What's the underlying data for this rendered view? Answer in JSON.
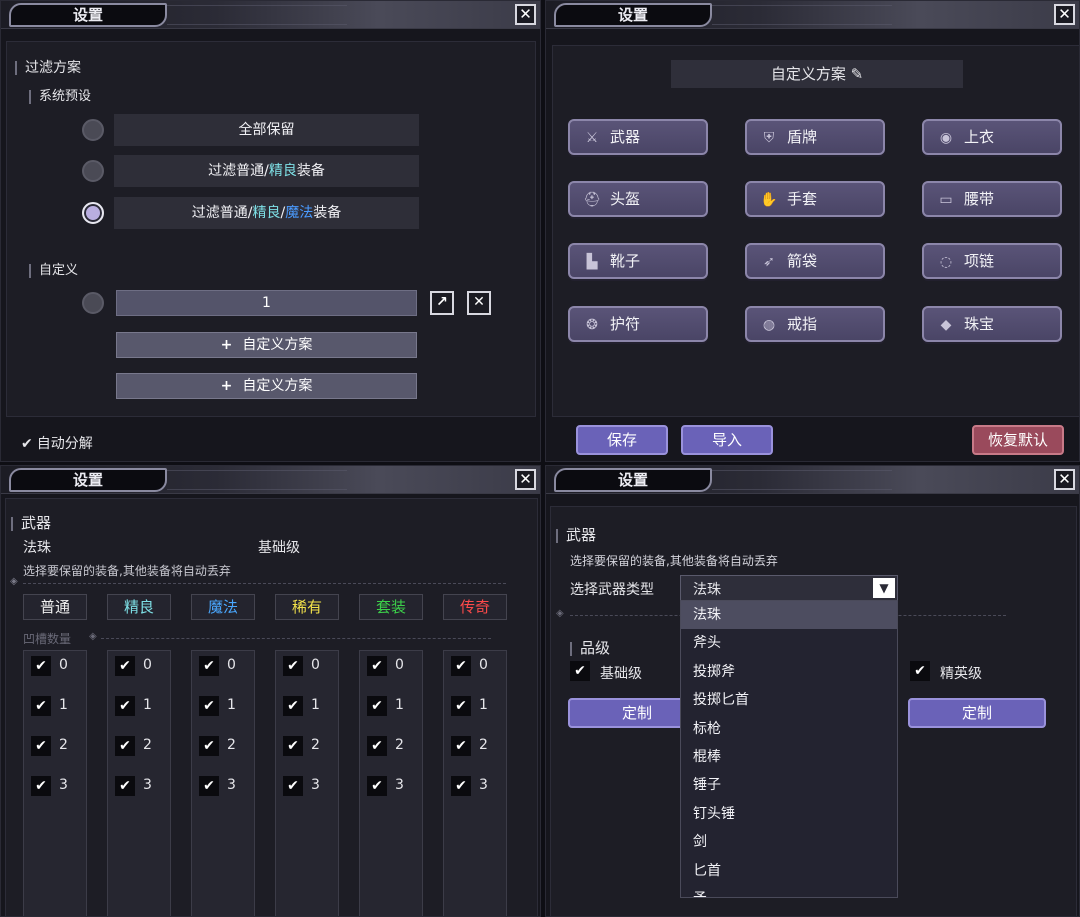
{
  "window_title": "设置",
  "close_glyph": "✕",
  "panel1": {
    "filter_title": "过滤方案",
    "system_preset": "系统预设",
    "options": [
      {
        "parts": [
          {
            "t": "全部保留",
            "c": ""
          }
        ]
      },
      {
        "parts": [
          {
            "t": "过滤普通/",
            "c": ""
          },
          {
            "t": "精良",
            "c": "#7ee0e6"
          },
          {
            "t": "装备",
            "c": ""
          }
        ]
      },
      {
        "parts": [
          {
            "t": "过滤普通/",
            "c": ""
          },
          {
            "t": "精良",
            "c": "#7ee0e6"
          },
          {
            "t": "/",
            "c": ""
          },
          {
            "t": "魔法",
            "c": "#4a9bff"
          },
          {
            "t": "装备",
            "c": ""
          }
        ]
      }
    ],
    "custom_title": "自定义",
    "custom_value": "1",
    "add_label": "自定义方案",
    "add_icon": "+",
    "auto_decompose": "自动分解",
    "check_glyph": "✔"
  },
  "panel2": {
    "scheme_name": "自定义方案",
    "edit_icon": "✎",
    "slots": [
      {
        "label": "武器",
        "icon": "sword-icon",
        "glyph": "⚔"
      },
      {
        "label": "盾牌",
        "icon": "shield-icon",
        "glyph": "⛨"
      },
      {
        "label": "上衣",
        "icon": "armor-icon",
        "glyph": "◉"
      },
      {
        "label": "头盔",
        "icon": "helmet-icon",
        "glyph": "⛑"
      },
      {
        "label": "手套",
        "icon": "glove-icon",
        "glyph": "✋"
      },
      {
        "label": "腰带",
        "icon": "belt-icon",
        "glyph": "▭"
      },
      {
        "label": "靴子",
        "icon": "boot-icon",
        "glyph": "▙"
      },
      {
        "label": "箭袋",
        "icon": "quiver-icon",
        "glyph": "➶"
      },
      {
        "label": "项链",
        "icon": "necklace-icon",
        "glyph": "◌"
      },
      {
        "label": "护符",
        "icon": "amulet-icon",
        "glyph": "❂"
      },
      {
        "label": "戒指",
        "icon": "ring-icon",
        "glyph": "◍"
      },
      {
        "label": "珠宝",
        "icon": "gem-icon",
        "glyph": "◆"
      }
    ],
    "save": "保存",
    "import": "导入",
    "reset": "恢复默认"
  },
  "panel3": {
    "section": "武器",
    "type": "法珠",
    "level": "基础级",
    "hint": "选择要保留的装备,其他装备将自动丢弃",
    "grades": [
      {
        "label": "普通",
        "color": "#f0f0f0"
      },
      {
        "label": "精良",
        "color": "#7ee0e6"
      },
      {
        "label": "魔法",
        "color": "#4aa8ff"
      },
      {
        "label": "稀有",
        "color": "#f2e24a"
      },
      {
        "label": "套装",
        "color": "#3cd04a"
      },
      {
        "label": "传奇",
        "color": "#ff4a4a"
      }
    ],
    "socket_label": "凹槽数量",
    "sockets": [
      "0",
      "1",
      "2",
      "3"
    ]
  },
  "panel4": {
    "section": "武器",
    "hint": "选择要保留的装备,其他装备将自动丢弃",
    "select_label": "选择武器类型",
    "selected": "法珠",
    "dropdown": [
      "法珠",
      "斧头",
      "投掷斧",
      "投掷匕首",
      "标枪",
      "棍棒",
      "锤子",
      "钉头锤",
      "剑",
      "匕首",
      "矛"
    ],
    "quality_title": "品级",
    "basic": "基础级",
    "elite": "精英级",
    "customize": "定制"
  }
}
